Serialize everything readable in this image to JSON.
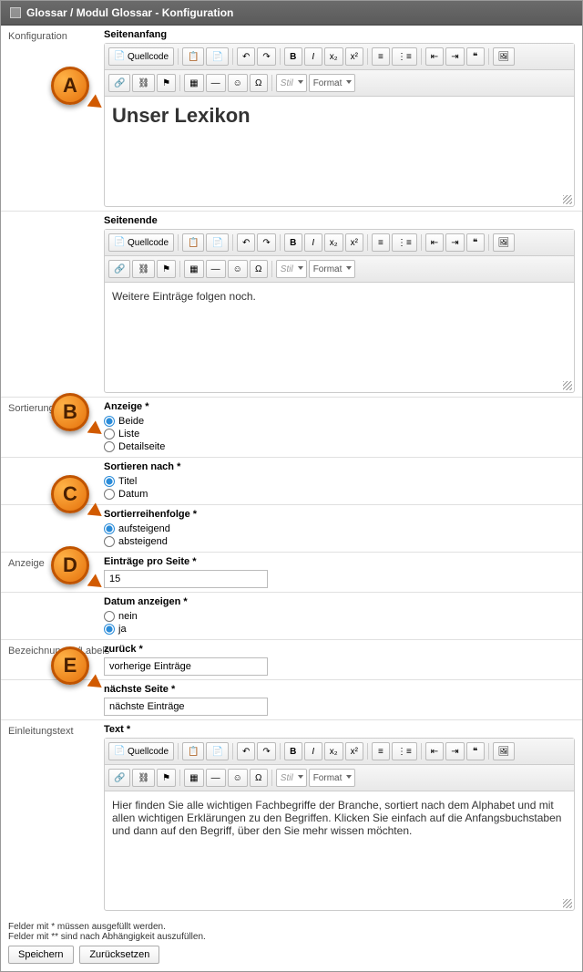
{
  "header": {
    "title": "Glossar / Modul Glossar - Konfiguration"
  },
  "sections": {
    "konfiguration": "Konfiguration",
    "sortierung": "Sortierung",
    "anzeige": "Anzeige",
    "bezeichnungen": "Bezeichnungen/Labels",
    "einleitung": "Einleitungstext"
  },
  "fields": {
    "seitenanfang": {
      "label": "Seitenanfang",
      "content": "Unser Lexikon"
    },
    "seitenende": {
      "label": "Seitenende",
      "content": "Weitere Einträge folgen noch."
    },
    "anzeige": {
      "label": "Anzeige *",
      "options": [
        "Beide",
        "Liste",
        "Detailseite"
      ],
      "selected": 0
    },
    "sortieren": {
      "label": "Sortieren nach *",
      "options": [
        "Titel",
        "Datum"
      ],
      "selected": 0
    },
    "reihenfolge": {
      "label": "Sortierreihenfolge *",
      "options": [
        "aufsteigend",
        "absteigend"
      ],
      "selected": 0
    },
    "eintraege": {
      "label": "Einträge pro Seite *",
      "value": "15"
    },
    "datum": {
      "label": "Datum anzeigen *",
      "options": [
        "nein",
        "ja"
      ],
      "selected": 1
    },
    "zurueck": {
      "label": "zurück *",
      "value": "vorherige Einträge"
    },
    "naechste": {
      "label": "nächste Seite *",
      "value": "nächste Einträge"
    },
    "text": {
      "label": "Text *",
      "content": "Hier finden Sie alle wichtigen Fachbegriffe der Branche, sortiert nach dem Alphabet und mit allen wichtigen Erklärungen zu den Begriffen. Klicken Sie einfach auf die Anfangsbuchstaben und dann auf den Begriff, über den Sie mehr wissen möchten."
    }
  },
  "toolbar": {
    "source": "Quellcode",
    "stil": "Stil",
    "format": "Format"
  },
  "footer": {
    "note1": "Felder mit * müssen ausgefüllt werden.",
    "note2": "Felder mit ** sind nach Abhängigkeit auszufüllen.",
    "save": "Speichern",
    "reset": "Zurücksetzen"
  },
  "callouts": {
    "a": "A",
    "b": "B",
    "c": "C",
    "d": "D",
    "e": "E"
  }
}
